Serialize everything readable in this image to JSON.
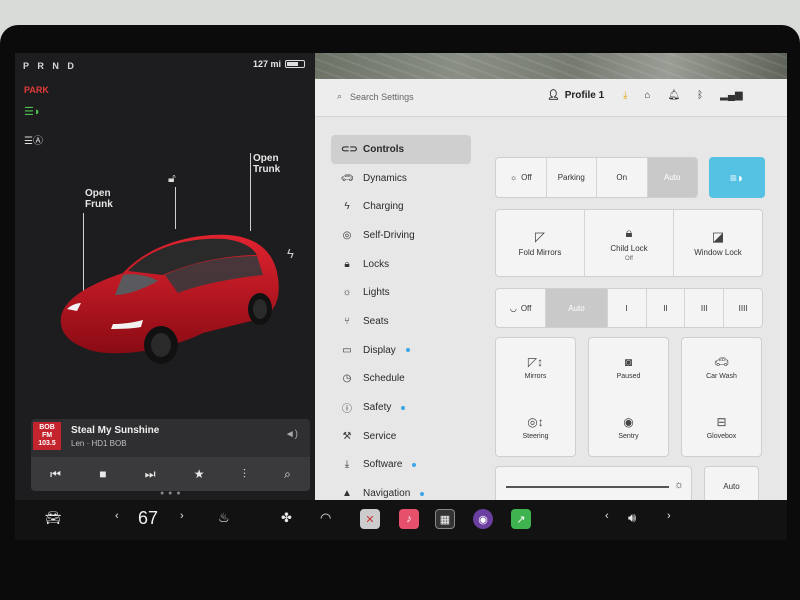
{
  "left": {
    "gear": "P R N D",
    "range": "127 mi",
    "park": "PARK",
    "open_frunk": [
      "Open",
      "Frunk"
    ],
    "open_trunk": [
      "Open",
      "Trunk"
    ],
    "media": {
      "station_logo": [
        "BOB",
        "FM",
        "103.5"
      ],
      "title": "Steal My Sunshine",
      "subtitle": "Len · HD1 BOB"
    }
  },
  "settings": {
    "search_placeholder": "Search Settings",
    "profile": "Profile 1",
    "menu": [
      {
        "label": "Controls",
        "icon": "toggle-icon"
      },
      {
        "label": "Dynamics",
        "icon": "car-icon"
      },
      {
        "label": "Charging",
        "icon": "bolt-icon"
      },
      {
        "label": "Self-Driving",
        "icon": "steering-icon"
      },
      {
        "label": "Locks",
        "icon": "lock-icon"
      },
      {
        "label": "Lights",
        "icon": "sun-icon"
      },
      {
        "label": "Seats",
        "icon": "seat-icon"
      },
      {
        "label": "Display",
        "icon": "display-icon"
      },
      {
        "label": "Schedule",
        "icon": "clock-icon"
      },
      {
        "label": "Safety",
        "icon": "shield-icon"
      },
      {
        "label": "Service",
        "icon": "wrench-icon"
      },
      {
        "label": "Software",
        "icon": "download-icon"
      },
      {
        "label": "Navigation",
        "icon": "navigation-icon"
      }
    ],
    "lights": [
      "Off",
      "Parking",
      "On",
      "Auto"
    ],
    "mirrors_row": [
      {
        "label": "Fold Mirrors",
        "sub": ""
      },
      {
        "label": "Child Lock",
        "sub": "Off"
      },
      {
        "label": "Window Lock",
        "sub": ""
      }
    ],
    "wipers": [
      "Off",
      "Auto",
      "I",
      "II",
      "III",
      "IIII"
    ],
    "grid": [
      {
        "label": "Mirrors"
      },
      {
        "label": "Paused"
      },
      {
        "label": "Car Wash"
      },
      {
        "label": "Steering"
      },
      {
        "label": "Sentry"
      },
      {
        "label": "Glovebox"
      }
    ],
    "brightness_auto": "Auto"
  },
  "taskbar": {
    "temperature": "67"
  },
  "colors": {
    "accent_blue": "#55c2e4",
    "park_red": "#e03a3a",
    "car_red": "#c8101e"
  }
}
